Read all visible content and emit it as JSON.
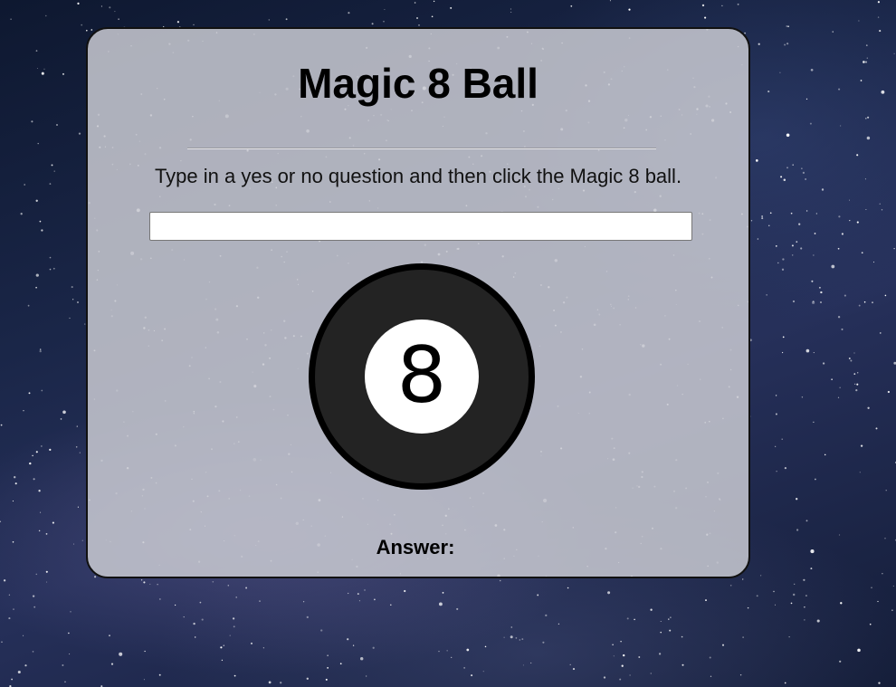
{
  "app": {
    "title": "Magic 8 Ball",
    "instructions": "Type in a yes or no question and then click the Magic 8 ball."
  },
  "question": {
    "value": "",
    "placeholder": ""
  },
  "ball": {
    "number": "8",
    "icon": "magic-8-ball-icon"
  },
  "answer": {
    "label": "Answer:",
    "value": ""
  },
  "colors": {
    "card_background": "#c8cad2",
    "card_border": "#111111",
    "ball_body": "#232323",
    "ball_outline": "#000000",
    "ball_window": "#ffffff",
    "sky": "#1a2648"
  }
}
